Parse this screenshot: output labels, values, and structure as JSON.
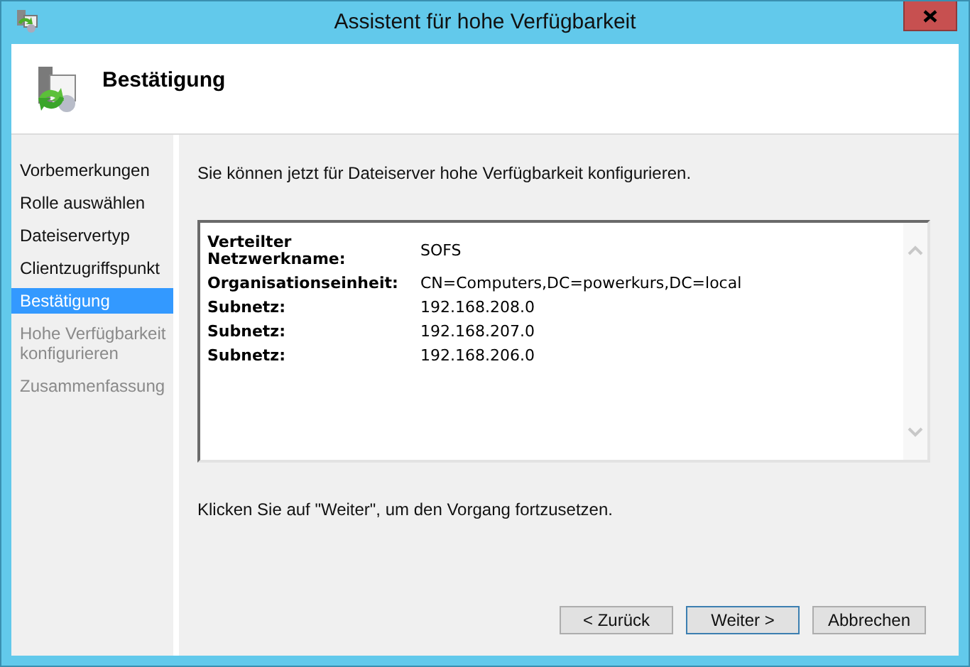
{
  "window": {
    "title": "Assistent für hohe Verfügbarkeit"
  },
  "header": {
    "title": "Bestätigung"
  },
  "sidebar": {
    "items": [
      {
        "label": "Vorbemerkungen",
        "selected": false,
        "disabled": false
      },
      {
        "label": "Rolle auswählen",
        "selected": false,
        "disabled": false
      },
      {
        "label": "Dateiservertyp",
        "selected": false,
        "disabled": false
      },
      {
        "label": "Clientzugriffspunkt",
        "selected": false,
        "disabled": false
      },
      {
        "label": "Bestätigung",
        "selected": true,
        "disabled": false
      },
      {
        "label": "Hohe Verfügbarkeit konfigurieren",
        "selected": false,
        "disabled": true
      },
      {
        "label": "Zusammenfassung",
        "selected": false,
        "disabled": true
      }
    ]
  },
  "intro": "Sie können jetzt für Dateiserver hohe Verfügbarkeit konfigurieren.",
  "summary": {
    "rows": [
      {
        "label": "Verteilter Netzwerkname:",
        "value": "SOFS"
      },
      {
        "label": "Organisationseinheit:",
        "value": "CN=Computers,DC=powerkurs,DC=local"
      },
      {
        "label": "Subnetz:",
        "value": "192.168.208.0"
      },
      {
        "label": "Subnetz:",
        "value": "192.168.207.0"
      },
      {
        "label": "Subnetz:",
        "value": "192.168.206.0"
      }
    ]
  },
  "hint": "Klicken Sie auf \"Weiter\", um den Vorgang fortzusetzen.",
  "buttons": [
    {
      "label": "< Zurück",
      "default": false
    },
    {
      "label": "Weiter >",
      "default": true
    },
    {
      "label": "Abbrechen",
      "default": false
    }
  ]
}
